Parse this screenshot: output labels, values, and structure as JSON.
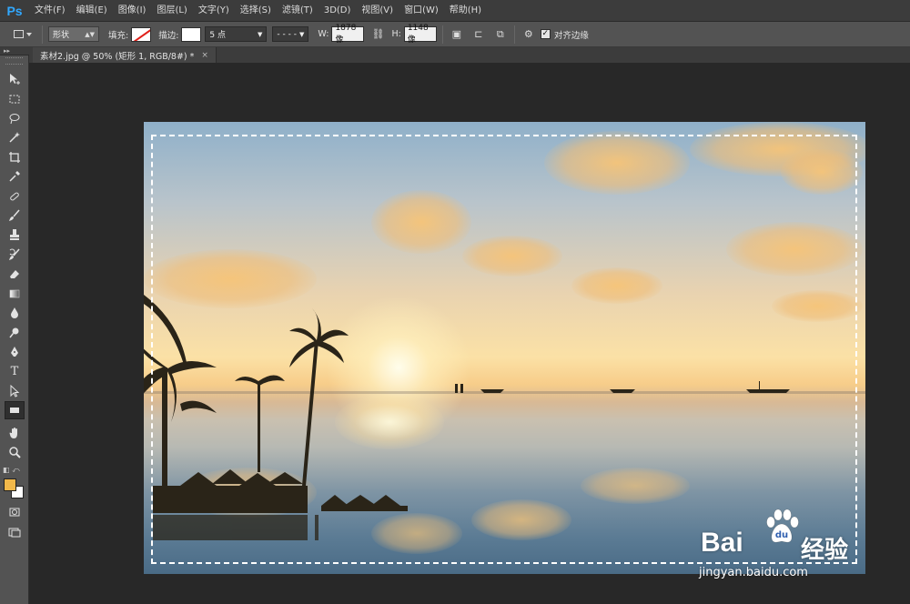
{
  "app": {
    "logo": "Ps"
  },
  "menu": [
    "文件(F)",
    "编辑(E)",
    "图像(I)",
    "图层(L)",
    "文字(Y)",
    "选择(S)",
    "滤镜(T)",
    "3D(D)",
    "视图(V)",
    "窗口(W)",
    "帮助(H)"
  ],
  "options": {
    "mode_value": "形状",
    "fill_label": "填充:",
    "stroke_label": "描边:",
    "stroke_width": "5 点",
    "w_label": "W:",
    "w_value": "1878 像",
    "h_label": "H:",
    "h_value": "1148 像",
    "align_edges_label": "对齐边缘",
    "align_edges_checked": true
  },
  "document_tab": {
    "title": "素材2.jpg @ 50% (矩形 1, RGB/8#) *",
    "close": "×"
  },
  "colors": {
    "foreground": "#f1b84a",
    "background": "#ffffff"
  },
  "tools": [
    "move-tool",
    "marquee-tool",
    "lasso-tool",
    "magic-wand-tool",
    "crop-tool",
    "eyedropper-tool",
    "healing-brush-tool",
    "brush-tool",
    "clone-stamp-tool",
    "history-brush-tool",
    "eraser-tool",
    "gradient-tool",
    "blur-tool",
    "dodge-tool",
    "pen-tool",
    "type-tool",
    "path-selection-tool",
    "rectangle-tool",
    "hand-tool",
    "zoom-tool"
  ],
  "watermark": {
    "brand": "Bai",
    "brand_cn": "经验",
    "url": "jingyan.baidu.com"
  }
}
